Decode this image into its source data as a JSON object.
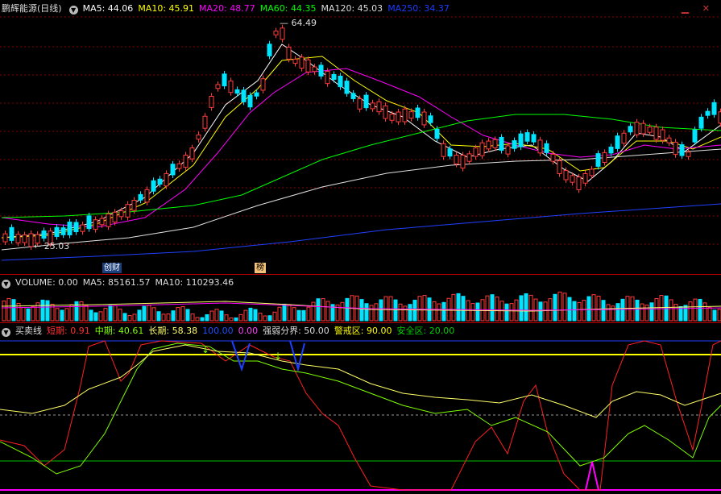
{
  "main_header": {
    "title": "鹏辉能源(日线)",
    "ma5": "MA5: 44.06",
    "ma10": "MA10: 45.91",
    "ma20": "MA20: 48.77",
    "ma60": "MA60: 44.35",
    "ma120": "MA120: 45.03",
    "ma250": "MA250: 34.37",
    "colors": {
      "ma5": "#ffffff",
      "ma10": "#ffff00",
      "ma20": "#ff00ff",
      "ma60": "#00ff00",
      "ma120": "#dddddd",
      "ma250": "#1a3cff"
    }
  },
  "price_annotations": {
    "high_label": "64.49",
    "low_label": "25.03"
  },
  "badges": {
    "badge1": "创财",
    "badge2": "榜"
  },
  "volume_header": {
    "title": "VOLUME: 0.00",
    "ma5": "MA5: 85161.57",
    "ma10": "MA10: 110293.46"
  },
  "indicator_header": {
    "title": "买卖线",
    "short": "短期: 0.91",
    "mid": "中期: 40.61",
    "long": "长期: 58.38",
    "v100": "100.00",
    "v0": "0.00",
    "boundary": "强弱分界: 50.00",
    "warning": "警戒区: 90.00",
    "safe": "安全区: 20.00"
  },
  "icons": {
    "collapse": "chevron-down-icon",
    "minimize": "minimize-icon",
    "close": "close-icon"
  }
}
